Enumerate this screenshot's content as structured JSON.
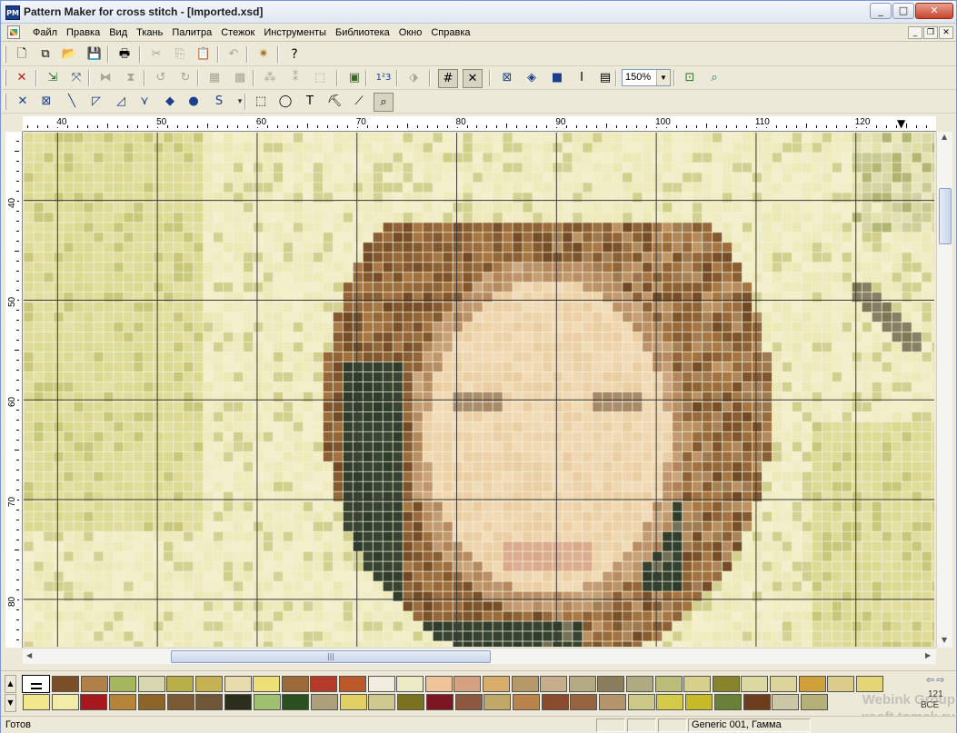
{
  "window": {
    "title": "Pattern Maker for cross stitch - [Imported.xsd]",
    "app_icon_text": "PM",
    "caption_buttons": {
      "minimize": "_",
      "maximize": "□",
      "close": "✕"
    }
  },
  "menu": {
    "items": [
      "Файл",
      "Правка",
      "Вид",
      "Ткань",
      "Палитра",
      "Стежок",
      "Инструменты",
      "Библиотека",
      "Окно",
      "Справка"
    ],
    "mdi_buttons": {
      "minimize": "_",
      "restore": "❐",
      "close": "✕"
    }
  },
  "toolbar1": {
    "buttons": [
      {
        "name": "new-document-icon",
        "glyph": "🗋"
      },
      {
        "name": "new-from-template-icon",
        "glyph": "⧉"
      },
      {
        "name": "open-folder-icon",
        "glyph": "📂"
      },
      {
        "name": "save-icon",
        "glyph": "💾"
      },
      {
        "name": "print-icon",
        "glyph": "🖶"
      },
      {
        "name": "cut-icon",
        "glyph": "✂"
      },
      {
        "name": "copy-icon",
        "glyph": "⎘"
      },
      {
        "name": "paste-icon",
        "glyph": "📋"
      },
      {
        "name": "undo-icon",
        "glyph": "↶"
      },
      {
        "name": "stitch-wizard-icon",
        "glyph": "✷"
      },
      {
        "name": "help-icon",
        "glyph": "?"
      }
    ]
  },
  "toolbar2": {
    "buttons": [
      {
        "name": "delete-icon",
        "glyph": "✕"
      },
      {
        "name": "move-selection-icon",
        "glyph": "⇲"
      },
      {
        "name": "swap-stitch-icon",
        "glyph": "⤧"
      },
      {
        "name": "flip-horizontal-icon",
        "glyph": "⧓"
      },
      {
        "name": "flip-vertical-icon",
        "glyph": "⧗"
      },
      {
        "name": "rotate-left-icon",
        "glyph": "↺"
      },
      {
        "name": "rotate-right-icon",
        "glyph": "↻"
      },
      {
        "name": "grid-select-icon",
        "glyph": "▦"
      },
      {
        "name": "fill-pattern-icon",
        "glyph": "▩"
      },
      {
        "name": "scatter-icon",
        "glyph": "⁂"
      },
      {
        "name": "reduce-icon",
        "glyph": "⁑"
      },
      {
        "name": "marquee-icon",
        "glyph": "⬚"
      },
      {
        "name": "color-palette-icon",
        "glyph": "▣"
      },
      {
        "name": "numbering-icon",
        "glyph": "1²3"
      },
      {
        "name": "pattern-overview-icon",
        "glyph": "⬗"
      },
      {
        "name": "grid-icon",
        "glyph": "#"
      },
      {
        "name": "cross-icon",
        "glyph": "✕"
      },
      {
        "name": "symbol-view-icon",
        "glyph": "⊠"
      },
      {
        "name": "blend-view-icon",
        "glyph": "◈"
      },
      {
        "name": "solid-view-icon",
        "glyph": "■"
      },
      {
        "name": "text-cursor-icon",
        "glyph": "I"
      },
      {
        "name": "page-icon",
        "glyph": "▤"
      },
      {
        "name": "fit-page-icon",
        "glyph": "⊡"
      },
      {
        "name": "zoom-magnifier-icon",
        "glyph": "⌕"
      }
    ],
    "zoom": {
      "value": "150%",
      "arrow": "▼"
    }
  },
  "toolbar3": {
    "buttons": [
      {
        "name": "full-cross-icon",
        "glyph": "✕"
      },
      {
        "name": "three-quarter-cross-icon",
        "glyph": "⊠"
      },
      {
        "name": "half-stitch-icon",
        "glyph": "╲"
      },
      {
        "name": "quarter-stitch-icon",
        "glyph": "◸"
      },
      {
        "name": "back-stitch-icon",
        "glyph": "◿"
      },
      {
        "name": "long-stitch-icon",
        "glyph": "⋎"
      },
      {
        "name": "french-knot-icon",
        "glyph": "◆"
      },
      {
        "name": "bead-icon",
        "glyph": "●"
      },
      {
        "name": "special-stitch-icon",
        "glyph": "S"
      },
      {
        "name": "dropdown-arrow-icon",
        "glyph": "▾"
      },
      {
        "name": "rect-select-icon",
        "glyph": "⬚"
      },
      {
        "name": "lasso-icon",
        "glyph": "◯"
      },
      {
        "name": "text-tool-icon",
        "glyph": "T"
      },
      {
        "name": "fill-bucket-icon",
        "glyph": "⛏"
      },
      {
        "name": "eyedropper-icon",
        "glyph": "⟋"
      },
      {
        "name": "magnifier-icon",
        "glyph": "⌕"
      }
    ]
  },
  "rulers": {
    "top_labels": [
      "40",
      "50",
      "60",
      "70",
      "80",
      "90",
      "100",
      "110",
      "120"
    ],
    "left_labels": [
      "40",
      "50",
      "60",
      "70",
      "80"
    ],
    "marker": "▼"
  },
  "scrollbar": {
    "h_thumb_grip": "|||"
  },
  "palette": {
    "row1": [
      "#7a4e26",
      "#b08048",
      "#a6b65c",
      "#d8d6b0",
      "#b8ae48",
      "#c6b252",
      "#e8dcac",
      "#ece076",
      "#9c6a38",
      "#b63a2a",
      "#ba5a2a",
      "#f0ece0",
      "#ecebc6",
      "#f0c498",
      "#d4a282",
      "#d8ae6a",
      "#b49868",
      "#c6ae8c",
      "#b4aa84",
      "#8c7e5c",
      "#b0aa82",
      "#bcbc7a",
      "#d6d08c",
      "#88842c",
      "#dcd8a2",
      "#dcd49a",
      "#d0a03a",
      "#dccc8c",
      "#e4d676"
    ],
    "row2": [
      "#f0e88a",
      "#f2eca8",
      "#a6181e",
      "#b48438",
      "#8c6428",
      "#7a5a32",
      "#6e5636",
      "#2c2e1c",
      "#9ec070",
      "#2a5020",
      "#aca07a",
      "#e0d064",
      "#cec88e",
      "#7a721e",
      "#7c1620",
      "#8c5840",
      "#c0a868",
      "#b8844c",
      "#8a4a2c",
      "#96643e",
      "#b4946c",
      "#ccc888",
      "#d2ca48",
      "#c6ba28",
      "#6a8038",
      "#6c3e1e",
      "#cac6a6",
      "#b4b078"
    ],
    "nav": "⇦⇨",
    "count": "121",
    "all_label": "ВСЕ"
  },
  "watermark": {
    "line1": "Webink Group",
    "line2": "xsoft.tomsk.ru"
  },
  "status": {
    "text": "Готов",
    "thread": "Generic 001, Гамма"
  },
  "canvas": {
    "grid_line_color": "#3a3a3a",
    "fine_grid_color": "#f4f0d8"
  }
}
